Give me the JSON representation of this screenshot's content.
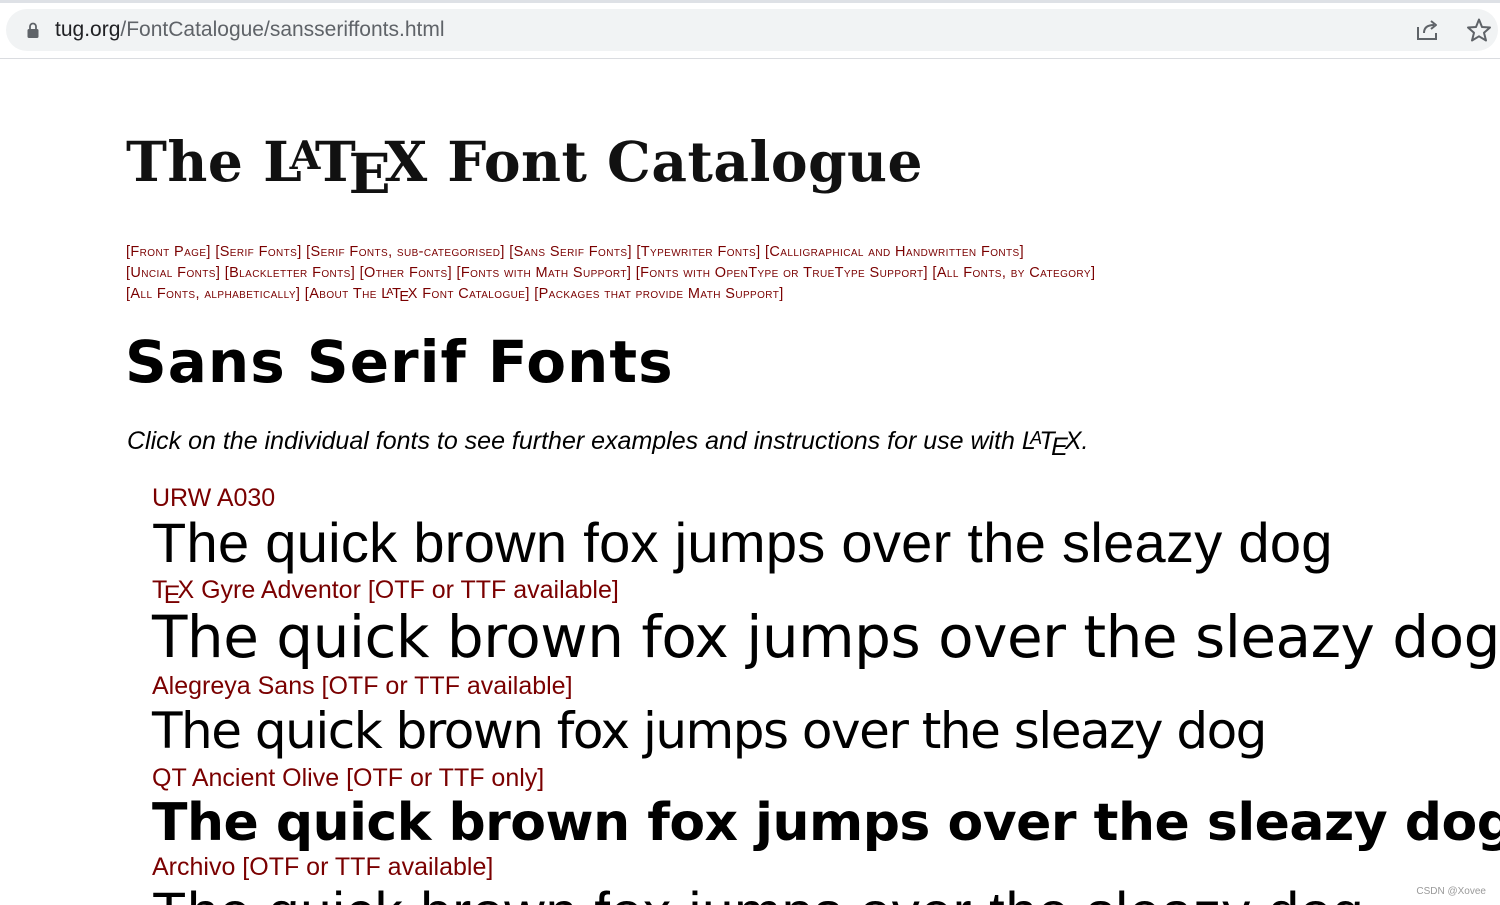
{
  "browser": {
    "url_host": "tug.org",
    "url_path": "/FontCatalogue/sansseriffonts.html",
    "icons": {
      "lock": "lock-icon",
      "share": "share-icon",
      "bookmark": "star-icon"
    }
  },
  "page": {
    "title_prefix": "The",
    "title_suffix": "Font Catalogue",
    "latex": {
      "l": "L",
      "a": "A",
      "t": "T",
      "e": "E",
      "x": "X"
    },
    "nav": [
      "[Front Page]",
      "[Serif Fonts]",
      "[Serif Fonts, sub-categorised]",
      "[Sans Serif Fonts]",
      "[Typewriter Fonts]",
      "[Calligraphical and Handwritten Fonts]",
      "[Uncial Fonts]",
      "[Blackletter Fonts]",
      "[Other Fonts]",
      "[Fonts with Math Support]",
      "[Fonts with OpenType or TrueType Support]",
      "[All Fonts, by Category]",
      "[All Fonts, alphabetically]",
      "[About The",
      "Font Catalogue]",
      "[Packages that provide Math Support]"
    ],
    "heading": "Sans Serif Fonts",
    "intro": "Click on the individual fonts to see further examples and instructions for use with",
    "intro_end": ".",
    "sample_text": "The quick brown fox jumps over the sleazy dog",
    "fonts": [
      {
        "name": "URW A030"
      },
      {
        "name_prefix": "T",
        "name_e": "E",
        "name_x": "X",
        "name": " Gyre Adventor [OTF or TTF available]"
      },
      {
        "name": "Alegreya Sans [OTF or TTF available]"
      },
      {
        "name": "QT Ancient Olive [OTF or TTF only]"
      },
      {
        "name": "Archivo [OTF or TTF available]"
      }
    ],
    "watermark": "CSDN @Xovee"
  },
  "colors": {
    "link": "#7a0000",
    "text": "#000000"
  }
}
